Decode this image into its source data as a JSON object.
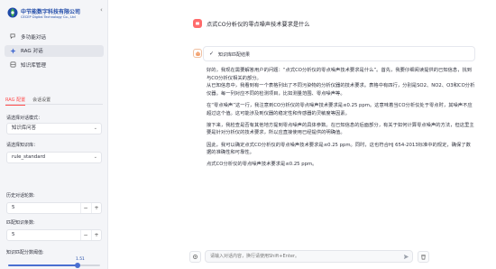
{
  "brand": {
    "name_cn": "中节能数字科技有限公司",
    "name_en": "CECEP Digital Technology Co., Ltd",
    "logo_icon": "cecep-logo"
  },
  "sidebar": {
    "collapse_icon": "chevron-left-icon",
    "nav": [
      {
        "label": "多功能对话",
        "icon": "chat-bubbles-icon",
        "active": false
      },
      {
        "label": "RAG 对话",
        "icon": "rag-sparkle-icon",
        "active": true
      },
      {
        "label": "知识库管理",
        "icon": "database-icon",
        "active": false
      }
    ],
    "tabs": [
      {
        "label": "RAG 配置",
        "active": true
      },
      {
        "label": "会话设置",
        "active": false
      }
    ],
    "fields": {
      "dialog_mode_label": "请选择对话模式：",
      "dialog_mode_value": "知识库问答",
      "kb_label": "请选择知识库：",
      "kb_value": "rule_standard",
      "history_label": "历史对话轮数:",
      "history_value": "5",
      "match_label": "匹配知识条数:",
      "match_value": "5",
      "threshold_label": "知识匹配分数阈值:",
      "threshold_value": "1.51",
      "threshold_range": [
        0,
        2
      ]
    }
  },
  "chat": {
    "user_message": "点式CO分析仪的零点噪声技术要求是什么",
    "expander_label": "知识库匹配结果",
    "answer_paragraphs": [
      "好的，我现在需要解答用户的问题：“点式CO分析仪的零点噪声技术要求是什么”。首先，我要仔细阅读提供的已知信息，找到与CO分析仪相关的部分。",
      "从已知信息中，我看到有一个表格列出了不同污染物的分析仪器的技术要求。表格中有四行，分别是SO2、NO2、O3和CO分析仪器。每一列对应不同的检测项目，比如测量范围、零点噪声等。",
      "在“零点噪声”这一行，我注意到CO分析仪的零点噪声技术要求是≤0.25 ppm。这意味着当CO分析仪处于零点时，其噪声不应超过这个值。这可能涉及到仪器的稳定性和传感器的灵敏度等因素。",
      "接下来，我检查是否有其他地方提到零点噪声的具体参数。在已知信息的后面部分，有关于如何计算零点噪声的方法，但这里主要是针对分析仪的技术要求，所以应直接使用已经提供的明确值。",
      "因此，我可以确定点式CO分析仪的零点噪声技术要求是≤0.25 ppm。同时，这也符合HJ 654-2013标准中的规定，确保了数据的准确性和可靠性。",
      "点式CO分析仪的零点噪声技术要求是≤0.25 ppm。"
    ]
  },
  "input_bar": {
    "placeholder": "请输入对话内容，换行请使用Shift+Enter。",
    "left_icon": "gear-icon",
    "send_icon": "send-icon",
    "right_icon": "trash-icon"
  },
  "colors": {
    "accent": "#ff4b4b",
    "brand_blue": "#1f4aa8",
    "slider": "#4a6fd1"
  }
}
